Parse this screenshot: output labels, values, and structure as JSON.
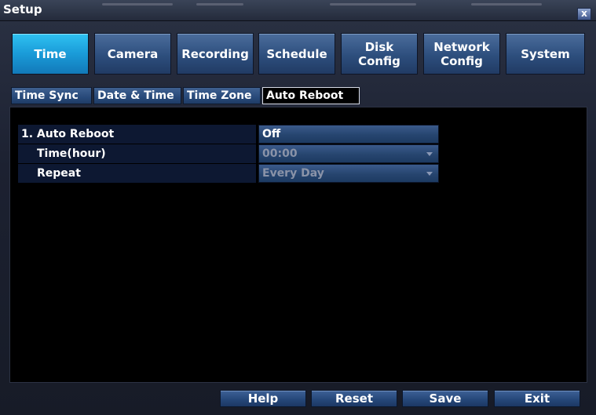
{
  "window": {
    "title": "Setup",
    "close_symbol": "x"
  },
  "main_tabs": [
    {
      "label": "Time",
      "active": true
    },
    {
      "label": "Camera"
    },
    {
      "label": "Recording"
    },
    {
      "label": "Schedule"
    },
    {
      "label": "Disk\nConfig"
    },
    {
      "label": "Network\nConfig"
    },
    {
      "label": "System"
    }
  ],
  "sub_tabs": [
    {
      "label": "Time Sync"
    },
    {
      "label": "Date & Time"
    },
    {
      "label": "Time Zone"
    },
    {
      "label": "Auto Reboot",
      "active": true
    }
  ],
  "settings": [
    {
      "label": "1. Auto Reboot",
      "value": "Off"
    },
    {
      "label": "Time(hour)",
      "value": "00:00",
      "disabled": true
    },
    {
      "label": "Repeat",
      "value": "Every Day",
      "disabled": true
    }
  ],
  "footer": {
    "help": "Help",
    "reset": "Reset",
    "save": "Save",
    "exit": "Exit"
  },
  "colors": {
    "active_tab": "#1a9bd8",
    "tab": "#2d4e7d",
    "background": "#000000"
  }
}
